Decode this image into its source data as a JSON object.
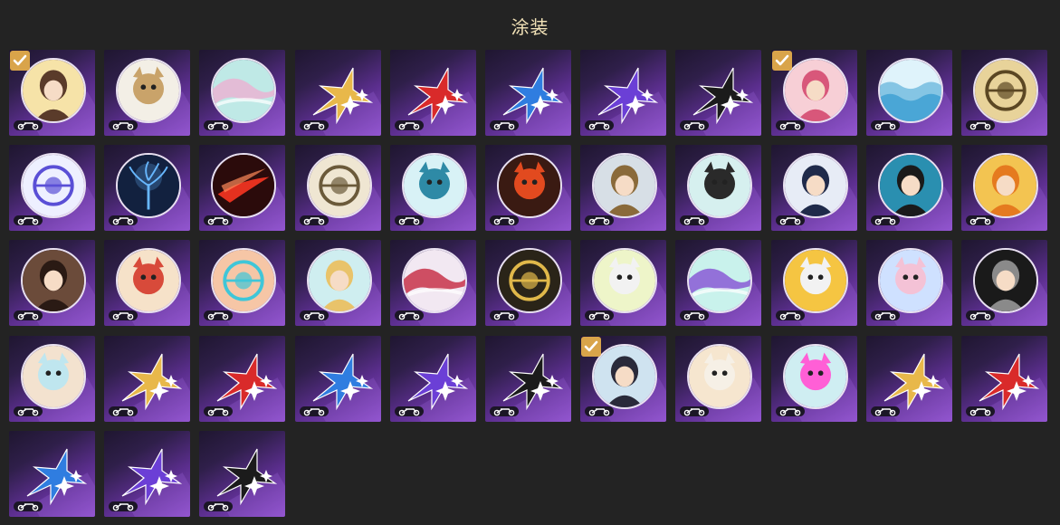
{
  "header": {
    "title": "涂装"
  },
  "items": [
    {
      "kind": "badge",
      "theme": "portrait",
      "c1": "#f6e3a8",
      "c2": "#5a3b2a",
      "selected": true,
      "icon": "character-portrait-icon"
    },
    {
      "kind": "badge",
      "theme": "character",
      "c1": "#f3efe6",
      "c2": "#c9a36a",
      "selected": false,
      "icon": "white-creature-icon"
    },
    {
      "kind": "badge",
      "theme": "swirl",
      "c1": "#bfe9e6",
      "c2": "#e9b4d2",
      "selected": false,
      "icon": "pastel-swirl-icon"
    },
    {
      "kind": "star",
      "color": "#e8b84a",
      "selected": false,
      "icon": "gold-star-icon"
    },
    {
      "kind": "star",
      "color": "#d92a2a",
      "selected": false,
      "icon": "red-star-icon"
    },
    {
      "kind": "star",
      "color": "#2f7de0",
      "selected": false,
      "icon": "blue-star-icon"
    },
    {
      "kind": "star",
      "color": "#6b3fd6",
      "selected": false,
      "icon": "purple-star-icon"
    },
    {
      "kind": "star",
      "color": "#1b1b1b",
      "selected": false,
      "icon": "black-star-icon"
    },
    {
      "kind": "badge",
      "theme": "portrait",
      "c1": "#f7cfd6",
      "c2": "#d8577a",
      "selected": true,
      "icon": "pink-character-icon"
    },
    {
      "kind": "badge",
      "theme": "waves",
      "c1": "#dff3fb",
      "c2": "#4aa6d6",
      "selected": false,
      "icon": "waves-icon"
    },
    {
      "kind": "badge",
      "theme": "emblem",
      "c1": "#e8d39a",
      "c2": "#5b4723",
      "selected": false,
      "icon": "gold-emblem-icon"
    },
    {
      "kind": "badge",
      "theme": "emblem",
      "c1": "#eef0ff",
      "c2": "#5a4fd6",
      "selected": false,
      "icon": "winged-crest-icon"
    },
    {
      "kind": "badge",
      "theme": "tree",
      "c1": "#12213f",
      "c2": "#67b7ff",
      "selected": false,
      "icon": "glowing-tree-icon"
    },
    {
      "kind": "badge",
      "theme": "flame",
      "c1": "#2b0b0b",
      "c2": "#e5311f",
      "selected": false,
      "icon": "red-flame-icon"
    },
    {
      "kind": "badge",
      "theme": "emblem",
      "c1": "#efe6d2",
      "c2": "#6b5a3a",
      "selected": false,
      "icon": "ring-planet-icon"
    },
    {
      "kind": "badge",
      "theme": "character",
      "c1": "#d8f2f6",
      "c2": "#2e8aa6",
      "selected": false,
      "icon": "cyan-creature-icon"
    },
    {
      "kind": "badge",
      "theme": "character",
      "c1": "#3a1a12",
      "c2": "#e24a1f",
      "selected": false,
      "icon": "angry-bird-icon"
    },
    {
      "kind": "badge",
      "theme": "portrait",
      "c1": "#d7dfe6",
      "c2": "#8a6a3a",
      "selected": false,
      "icon": "warrior-portrait-icon"
    },
    {
      "kind": "badge",
      "theme": "character",
      "c1": "#d6f0ef",
      "c2": "#2a2a2a",
      "selected": false,
      "icon": "skeleton-character-icon"
    },
    {
      "kind": "badge",
      "theme": "portrait",
      "c1": "#e7ecf6",
      "c2": "#1f2a4a",
      "selected": false,
      "icon": "dark-hair-character-icon"
    },
    {
      "kind": "badge",
      "theme": "portrait",
      "c1": "#2a8fb0",
      "c2": "#1a1a1a",
      "selected": false,
      "icon": "blue-portrait-icon"
    },
    {
      "kind": "badge",
      "theme": "portrait",
      "c1": "#f3c451",
      "c2": "#e57a1f",
      "selected": false,
      "icon": "orange-hair-character-icon"
    },
    {
      "kind": "badge",
      "theme": "portrait",
      "c1": "#6b4b3a",
      "c2": "#2a1a14",
      "selected": false,
      "icon": "duo-portrait-icon"
    },
    {
      "kind": "badge",
      "theme": "character",
      "c1": "#f6e2c9",
      "c2": "#d84a3a",
      "selected": false,
      "icon": "castle-characters-icon"
    },
    {
      "kind": "badge",
      "theme": "emblem",
      "c1": "#f6c6a6",
      "c2": "#3fc6d8",
      "selected": false,
      "icon": "mecha-face-icon"
    },
    {
      "kind": "badge",
      "theme": "portrait",
      "c1": "#cfeef0",
      "c2": "#e9c36a",
      "selected": false,
      "icon": "blonde-character-icon"
    },
    {
      "kind": "badge",
      "theme": "swirl",
      "c1": "#f2e8f2",
      "c2": "#c8324a",
      "selected": false,
      "icon": "paint-streak-icon"
    },
    {
      "kind": "badge",
      "theme": "emblem",
      "c1": "#2a2418",
      "c2": "#e0b84a",
      "selected": false,
      "icon": "gold-wings-icon"
    },
    {
      "kind": "badge",
      "theme": "character",
      "c1": "#eef5c9",
      "c2": "#f2f2f2",
      "selected": false,
      "icon": "bunny-character-icon"
    },
    {
      "kind": "badge",
      "theme": "swirl",
      "c1": "#c9f2ec",
      "c2": "#8a5ad6",
      "selected": false,
      "icon": "sparkle-blob-icon"
    },
    {
      "kind": "badge",
      "theme": "character",
      "c1": "#f5c542",
      "c2": "#f2f2f2",
      "selected": false,
      "icon": "sheep-character-icon"
    },
    {
      "kind": "badge",
      "theme": "character",
      "c1": "#cfe1ff",
      "c2": "#f4c2d6",
      "selected": false,
      "icon": "pink-hair-character-icon"
    },
    {
      "kind": "badge",
      "theme": "portrait",
      "c1": "#1a1a1a",
      "c2": "#8a8a8a",
      "selected": false,
      "icon": "dark-robot-icon"
    },
    {
      "kind": "badge",
      "theme": "character",
      "c1": "#f3e2cf",
      "c2": "#bfe6ef",
      "selected": false,
      "icon": "teal-figure-icon"
    },
    {
      "kind": "star",
      "color": "#e8b84a",
      "selected": false,
      "icon": "gold-star-icon"
    },
    {
      "kind": "star",
      "color": "#d92a2a",
      "selected": false,
      "icon": "red-star-icon"
    },
    {
      "kind": "star",
      "color": "#2f7de0",
      "selected": false,
      "icon": "blue-star-icon"
    },
    {
      "kind": "star",
      "color": "#6b3fd6",
      "selected": false,
      "icon": "purple-star-icon"
    },
    {
      "kind": "star",
      "color": "#1b1b1b",
      "selected": false,
      "icon": "black-star-icon"
    },
    {
      "kind": "badge",
      "theme": "portrait",
      "c1": "#cfe3f0",
      "c2": "#2a2a3a",
      "selected": true,
      "icon": "black-hair-character-icon"
    },
    {
      "kind": "badge",
      "theme": "character",
      "c1": "#f6e6cf",
      "c2": "#f6f0e6",
      "selected": false,
      "icon": "white-hair-character-icon"
    },
    {
      "kind": "badge",
      "theme": "character",
      "c1": "#cfeef2",
      "c2": "#ff5fd6",
      "selected": false,
      "icon": "pink-cat-icon"
    },
    {
      "kind": "star",
      "color": "#e8b84a",
      "selected": false,
      "icon": "gold-star-icon"
    },
    {
      "kind": "star",
      "color": "#d92a2a",
      "selected": false,
      "icon": "red-star-icon"
    },
    {
      "kind": "star",
      "color": "#2f7de0",
      "selected": false,
      "icon": "blue-star-icon"
    },
    {
      "kind": "star",
      "color": "#6b3fd6",
      "selected": false,
      "icon": "purple-star-icon"
    },
    {
      "kind": "star",
      "color": "#1b1b1b",
      "selected": false,
      "icon": "black-star-icon"
    }
  ]
}
